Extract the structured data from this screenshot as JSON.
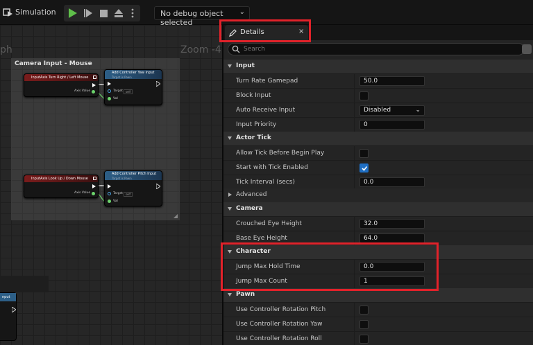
{
  "toolbar": {
    "simulation_label": "Simulation",
    "debug_select_value": "No debug object selected",
    "play_color": "#5fbf4a"
  },
  "graph": {
    "partial_title": "ph",
    "zoom_label": "Zoom -4",
    "comment_title": "Camera Input - Mouse",
    "nodes": {
      "mouse_turn": {
        "title": "InputAxis Turn Right / Left Mouse",
        "pin_axis": "Axis Value"
      },
      "yaw": {
        "title": "Add Controller Yaw Input",
        "subtitle": "Target is Pawn",
        "pin_target": "Target",
        "pin_self": "self",
        "pin_val": "Val"
      },
      "mouse_lookup": {
        "title": "InputAxis Look Up / Down Mouse",
        "pin_axis": "Axis Value"
      },
      "pitch": {
        "title": "Add Controller Pitch Input",
        "subtitle": "Target is Pawn",
        "pin_target": "Target",
        "pin_self": "self",
        "pin_val": "Val"
      },
      "side": {
        "title": "nput"
      }
    }
  },
  "details": {
    "tab_label": "Details",
    "tab_close": "×",
    "search_placeholder": "Search",
    "highlight_color": "#e2222a",
    "sections": {
      "input": {
        "title": "Input",
        "rows": {
          "turn_rate": {
            "label": "Turn Rate Gamepad",
            "value": "50.0"
          },
          "block_input": {
            "label": "Block Input",
            "checked": false
          },
          "auto_receive": {
            "label": "Auto Receive Input",
            "value": "Disabled"
          },
          "input_priority": {
            "label": "Input Priority",
            "value": "0"
          }
        }
      },
      "actor_tick": {
        "title": "Actor Tick",
        "rows": {
          "allow_tick": {
            "label": "Allow Tick Before Begin Play",
            "checked": false
          },
          "start_tick": {
            "label": "Start with Tick Enabled",
            "checked": true
          },
          "tick_interval": {
            "label": "Tick Interval (secs)",
            "value": "0.0"
          }
        }
      },
      "advanced": {
        "title": "Advanced"
      },
      "camera": {
        "title": "Camera",
        "rows": {
          "crouched_eye": {
            "label": "Crouched Eye Height",
            "value": "32.0"
          },
          "base_eye": {
            "label": "Base Eye Height",
            "value": "64.0"
          }
        }
      },
      "character": {
        "title": "Character",
        "rows": {
          "jump_hold": {
            "label": "Jump Max Hold Time",
            "value": "0.0"
          },
          "jump_count": {
            "label": "Jump Max Count",
            "value": "1"
          }
        }
      },
      "pawn": {
        "title": "Pawn",
        "rows": {
          "use_pitch": {
            "label": "Use Controller Rotation Pitch",
            "checked": false
          },
          "use_yaw": {
            "label": "Use Controller Rotation Yaw",
            "checked": false
          },
          "use_roll": {
            "label": "Use Controller Rotation Roll",
            "checked": false
          }
        }
      }
    }
  }
}
